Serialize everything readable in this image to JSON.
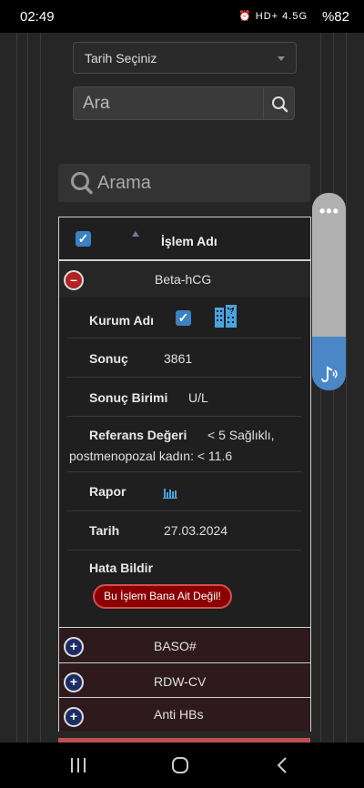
{
  "status_bar": {
    "time": "02:49",
    "icons": "⏰ HD+ 4.5G",
    "battery": "%82"
  },
  "filters": {
    "date_select": "Tarih Seçiniz",
    "search_placeholder": "Ara",
    "big_search_placeholder": "Arama"
  },
  "table": {
    "header": "İşlem Adı",
    "expanded_row": {
      "title": "Beta-hCG",
      "kurum_label": "Kurum Adı",
      "sonuc_label": "Sonuç",
      "sonuc_value": "3861",
      "birim_label": "Sonuç Birimi",
      "birim_value": "U/L",
      "referans_label": "Referans Değeri",
      "referans_value_1": "< 5 Sağlıklı,",
      "referans_value_2": "postmenopozal kadın: < 11.6",
      "rapor_label": "Rapor",
      "tarih_label": "Tarih",
      "tarih_value": "27.03.2024",
      "hata_label": "Hata Bildir",
      "hata_button": "Bu İşlem Bana Ait Değil!"
    },
    "other_rows": [
      "BASO#",
      "RDW-CV",
      "Anti HBs"
    ]
  },
  "colors": {
    "accent": "#3b82c4",
    "danger": "#8b0000",
    "row_bg": "#2e1a1d"
  }
}
